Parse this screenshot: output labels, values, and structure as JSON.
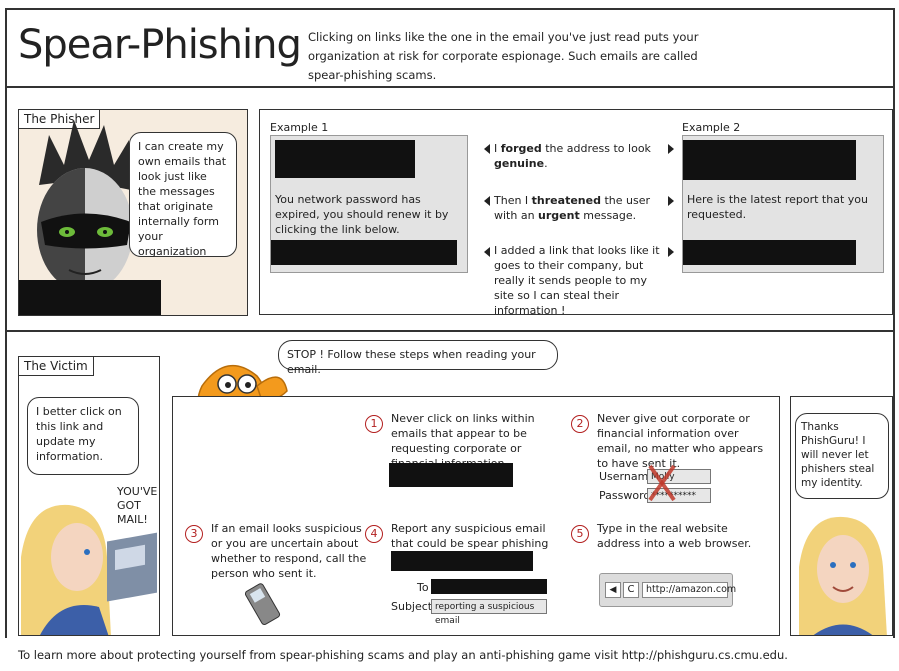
{
  "header": {
    "title": "Spear-Phishing",
    "intro": "Clicking on links like the one in the email you've just read puts your organization at risk for corporate espionage. Such emails are called spear-phishing scams."
  },
  "phisher": {
    "label": "The Phisher",
    "bubble": "I can create my own emails that look just like the messages that originate internally form your organization"
  },
  "examples": {
    "ex1_label": "Example 1",
    "ex1_body": "You network password has expired, you should renew it by clicking the link below.",
    "ex2_label": "Example 2",
    "ex2_body": "Here is the latest report that you requested.",
    "notes": [
      {
        "pre": "I ",
        "b1": "forged",
        "mid": " the address to look ",
        "b2": "genuine",
        "post": "."
      },
      {
        "pre": "Then I ",
        "b1": "threatened",
        "mid": " the user with an ",
        "b2": "urgent",
        "post": " message."
      },
      {
        "pre": "I added a link that looks like it goes to their company, but really it sends people to my site so I can steal their information !",
        "b1": "",
        "mid": "",
        "b2": "",
        "post": ""
      }
    ]
  },
  "victim": {
    "label": "The Victim",
    "bubble": "I better click on this link and update my information.",
    "mail_text": "YOU'VE GOT MAIL!"
  },
  "guru": {
    "bubble": "STOP ! Follow these steps when reading your email."
  },
  "steps": [
    {
      "num": "1",
      "text": "Never click on links within emails that appear to be requesting corporate or financial information."
    },
    {
      "num": "2",
      "text": "Never give out corporate or financial information over email, no matter who appears to have sent it."
    },
    {
      "num": "3",
      "text": "If an email looks suspicious or you are uncertain about whether to respond, call the person who sent it."
    },
    {
      "num": "4",
      "text": "Report any suspicious email that could be spear phishing to"
    },
    {
      "num": "5",
      "text": "Type in the real website address into a web browser."
    }
  ],
  "login": {
    "username_label": "Username",
    "username_value": "Molly",
    "password_label": "Password",
    "password_value": "**********"
  },
  "report": {
    "to_label": "To",
    "subject_label": "Subject",
    "subject_value": "reporting a suspicious email"
  },
  "browser": {
    "url": "http://amazon.com"
  },
  "thanks": {
    "bubble": "Thanks PhishGuru! I will never let phishers steal my identity."
  },
  "footer": {
    "text": "To learn more about protecting yourself from spear-phishing scams and play an anti-phishing game visit  http://phishguru.cs.cmu.edu."
  },
  "colors": {
    "accent_red": "#b32020",
    "fish_orange": "#f39a1d",
    "panel_bg": "#f6ecdf"
  }
}
